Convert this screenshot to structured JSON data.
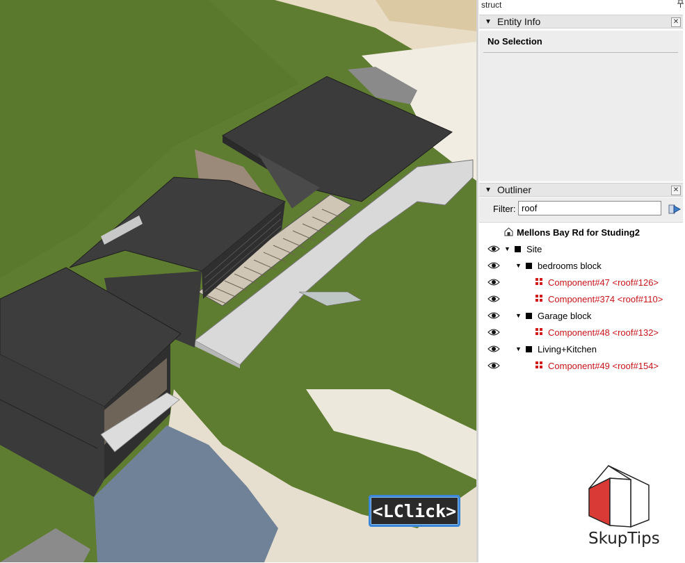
{
  "viewport": {
    "overlay_label": "<LClick>",
    "colors": {
      "grass": "#5e7c2f",
      "roof": "#3c3c3c",
      "deck": "#d6d6d6",
      "sand": "#e4dccb",
      "driveway": "#6a7f96"
    }
  },
  "tray": {
    "title": "struct",
    "pin_icon": "pin-icon"
  },
  "entity_info": {
    "title": "Entity Info",
    "selection_text": "No Selection"
  },
  "outliner": {
    "title": "Outliner",
    "filter_label": "Filter:",
    "filter_value": "roof",
    "model_name": "Mellons Bay Rd for Studing2",
    "rows": [
      {
        "label": "Site"
      },
      {
        "label": "bedrooms block"
      },
      {
        "label": "Component#47 <roof#126>"
      },
      {
        "label": "Component#374 <roof#110>"
      },
      {
        "label": "Garage block"
      },
      {
        "label": "Component#48 <roof#132>"
      },
      {
        "label": "Living+Kitchen"
      },
      {
        "label": "Component#49 <roof#154>"
      }
    ]
  },
  "branding": {
    "text": "SkupTips",
    "accent": "#d93a36"
  }
}
